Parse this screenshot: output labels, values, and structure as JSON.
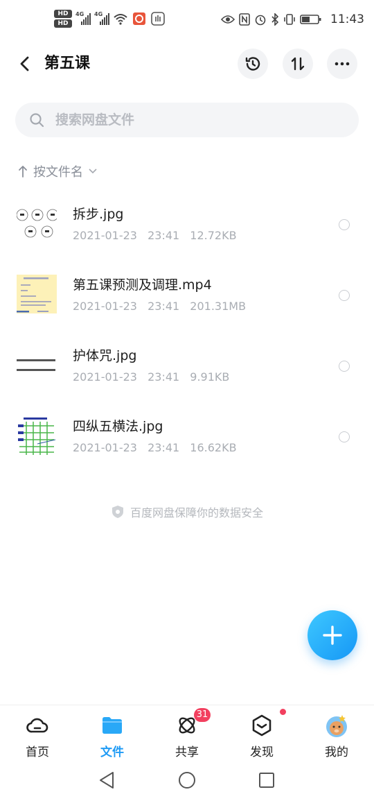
{
  "status_bar": {
    "time": "11:43",
    "hd1": "HD",
    "hd2": "HD",
    "net1": "4G",
    "net2": "4G",
    "icons": [
      "eye-icon",
      "nfc-icon",
      "alarm-icon",
      "bluetooth-icon",
      "vibrate-icon",
      "battery-icon"
    ]
  },
  "header": {
    "title": "第五课",
    "actions": [
      "history-icon",
      "transfer-icon",
      "more-icon"
    ]
  },
  "search": {
    "placeholder": "搜索网盘文件"
  },
  "sort": {
    "label": "按文件名"
  },
  "files": [
    {
      "name": "拆步.jpg",
      "date": "2021-01-23",
      "time": "23:41",
      "size": "12.72KB",
      "thumb": "circles-thumbnail"
    },
    {
      "name": "第五课预测及调理.mp4",
      "date": "2021-01-23",
      "time": "23:41",
      "size": "201.31MB",
      "thumb": "video-thumbnail"
    },
    {
      "name": "护体咒.jpg",
      "date": "2021-01-23",
      "time": "23:41",
      "size": "9.91KB",
      "thumb": "text-thumbnail"
    },
    {
      "name": "四纵五横法.jpg",
      "date": "2021-01-23",
      "time": "23:41",
      "size": "16.62KB",
      "thumb": "grid-thumbnail"
    }
  ],
  "footer_note": "百度网盘保障你的数据安全",
  "tabs": [
    {
      "label": "首页",
      "icon": "cloud-icon"
    },
    {
      "label": "文件",
      "icon": "folder-icon",
      "active": true
    },
    {
      "label": "共享",
      "icon": "share-icon",
      "badge": "31"
    },
    {
      "label": "我的",
      "icon": "avatar-icon"
    },
    {
      "label": "发现",
      "icon": "discover-icon"
    }
  ],
  "colors": {
    "accent": "#1f9bf5",
    "badge": "#f2405f",
    "fab": "#1697f6"
  }
}
